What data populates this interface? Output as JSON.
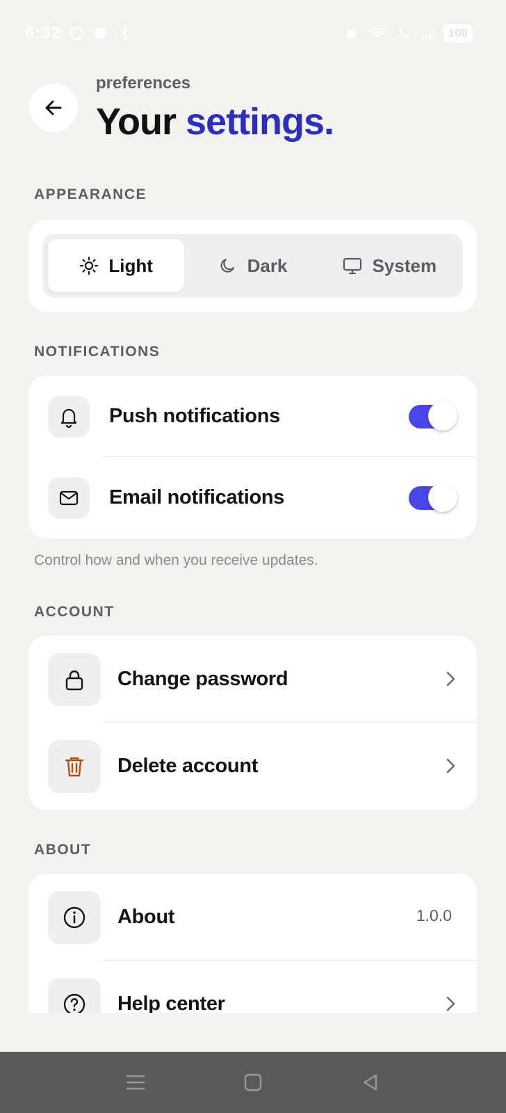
{
  "status_bar": {
    "time": "6:32",
    "battery": "100"
  },
  "header": {
    "subtitle": "preferences",
    "title_main": "Your ",
    "title_accent": "settings."
  },
  "appearance": {
    "label": "APPEARANCE",
    "options": [
      {
        "label": "Light",
        "icon": "sun-icon",
        "active": true
      },
      {
        "label": "Dark",
        "icon": "moon-icon",
        "active": false
      },
      {
        "label": "System",
        "icon": "monitor-icon",
        "active": false
      }
    ]
  },
  "notifications": {
    "label": "NOTIFICATIONS",
    "items": [
      {
        "label": "Push notifications",
        "icon": "bell-icon",
        "enabled": true
      },
      {
        "label": "Email notifications",
        "icon": "mail-icon",
        "enabled": true
      }
    ],
    "helper": "Control how and when you receive updates."
  },
  "account": {
    "label": "ACCOUNT",
    "items": [
      {
        "label": "Change password",
        "icon": "lock-icon"
      },
      {
        "label": "Delete account",
        "icon": "trash-icon"
      }
    ]
  },
  "about": {
    "label": "ABOUT",
    "items": [
      {
        "label": "About",
        "icon": "info-icon",
        "value": "1.0.0"
      },
      {
        "label": "Help center",
        "icon": "help-icon"
      }
    ]
  },
  "colors": {
    "background": "#f4f2ee",
    "accent": "#2b2fbf",
    "toggle_on": "#4a45e8",
    "danger": "#b0500f"
  }
}
